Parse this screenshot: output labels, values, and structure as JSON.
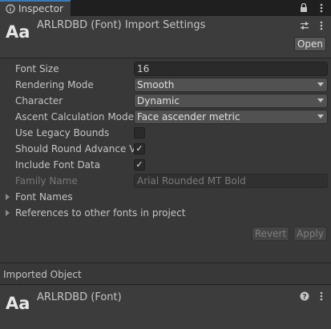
{
  "tab": {
    "label": "Inspector"
  },
  "header": {
    "icon_text": "Aa",
    "title": "ARLRDBD (Font) Import Settings",
    "open_label": "Open"
  },
  "fields": {
    "font_size": {
      "label": "Font Size",
      "value": "16"
    },
    "rendering_mode": {
      "label": "Rendering Mode",
      "value": "Smooth"
    },
    "character": {
      "label": "Character",
      "value": "Dynamic"
    },
    "ascent": {
      "label": "Ascent Calculation Mode",
      "value": "Face ascender metric"
    },
    "legacy_bounds": {
      "label": "Use Legacy Bounds",
      "checked": false
    },
    "round_advance": {
      "label": "Should Round Advance Value",
      "checked": true
    },
    "include_font_data": {
      "label": "Include Font Data",
      "checked": true
    },
    "family_name": {
      "label": "Family Name",
      "value": "Arial Rounded MT Bold"
    }
  },
  "foldouts": {
    "font_names": "Font Names",
    "references": "References to other fonts in project"
  },
  "buttons": {
    "revert": "Revert",
    "apply": "Apply"
  },
  "imported": {
    "section_title": "Imported Object",
    "icon_text": "Aa",
    "title": "ARLRDBD (Font)"
  },
  "checkmark": "✓"
}
